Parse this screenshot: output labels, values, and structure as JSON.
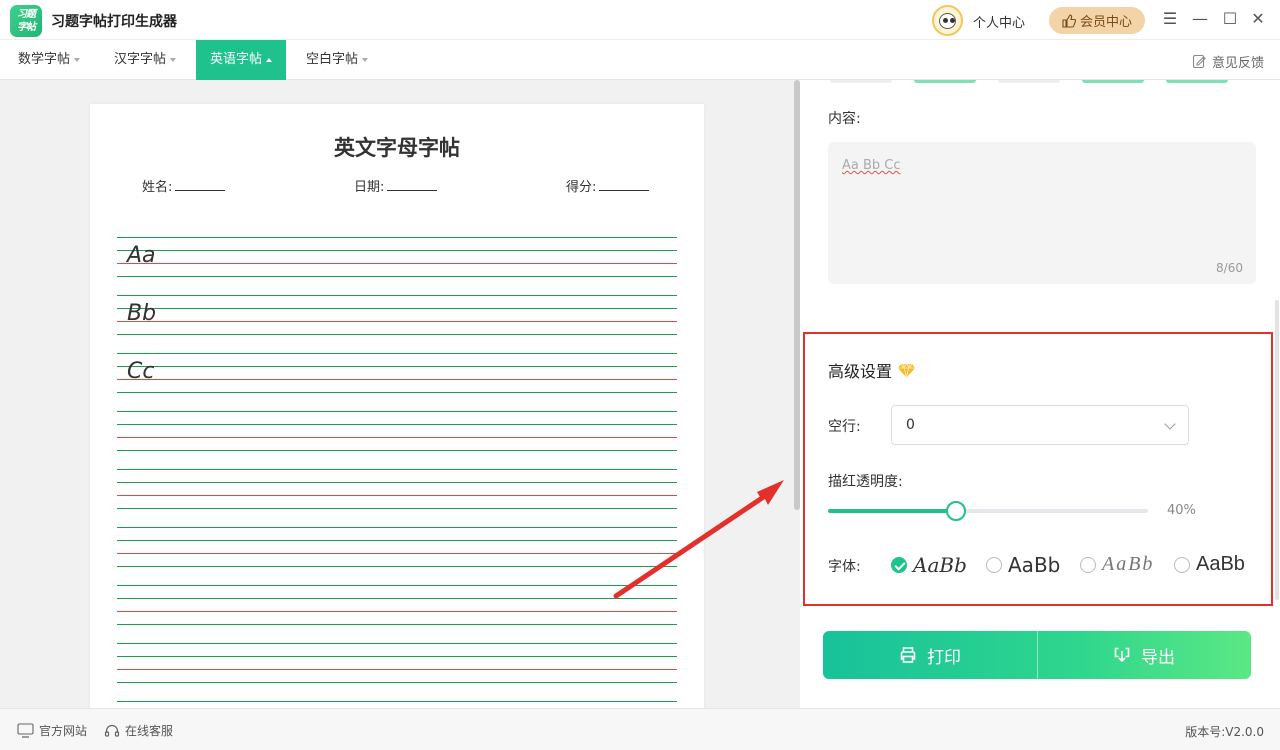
{
  "app": {
    "title": "习题字帖打印生成器",
    "logo_line1": "习题",
    "logo_line2": "字帖"
  },
  "header": {
    "user_center": "个人中心",
    "vip": "会员中心"
  },
  "tabs": [
    {
      "label": "数学字帖",
      "active": false
    },
    {
      "label": "汉字字帖",
      "active": false
    },
    {
      "label": "英语字帖",
      "active": true
    },
    {
      "label": "空白字帖",
      "active": false
    }
  ],
  "feedback": "意见反馈",
  "paper": {
    "title": "英文字母字帖",
    "name_label": "姓名:",
    "date_label": "日期:",
    "score_label": "得分:",
    "letters": [
      "Aa",
      "Bb",
      "Cc"
    ]
  },
  "content": {
    "label": "内容:",
    "value": "Aa Bb Cc",
    "count": "8/60"
  },
  "advanced": {
    "title": "高级设置",
    "blank_rows_label": "空行:",
    "blank_rows_value": "0",
    "opacity_label": "描红透明度:",
    "opacity_value": "40%",
    "opacity_fraction": 0.4,
    "font_label": "字体:",
    "font_options": [
      {
        "sample": "AaBb",
        "checked": true
      },
      {
        "sample": "AaBb",
        "checked": false
      },
      {
        "sample": "AaBb",
        "checked": false
      },
      {
        "sample": "AaBb",
        "checked": false
      }
    ]
  },
  "actions": {
    "print": "打印",
    "export": "导出"
  },
  "statusbar": {
    "website": "官方网站",
    "support": "在线客服",
    "version": "版本号:V2.0.0"
  },
  "colors": {
    "accent": "#1fc28c",
    "highlight": "#e3302b",
    "vip_bg": "#f3d4a9"
  }
}
